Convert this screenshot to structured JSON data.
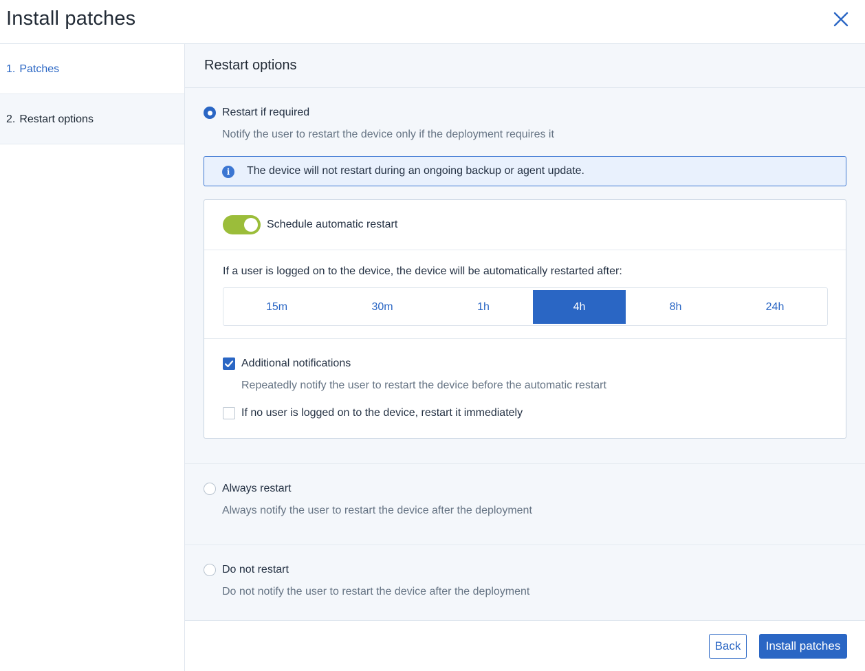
{
  "dialog": {
    "title": "Install patches"
  },
  "steps": [
    {
      "num": "1.",
      "label": "Patches"
    },
    {
      "num": "2.",
      "label": "Restart options"
    }
  ],
  "section": {
    "title": "Restart options"
  },
  "options": {
    "restart_if_required": {
      "label": "Restart if required",
      "description": "Notify the user to restart the device only if the deployment requires it",
      "selected": true
    },
    "always_restart": {
      "label": "Always restart",
      "description": "Always notify the user to restart the device after the deployment",
      "selected": false
    },
    "do_not_restart": {
      "label": "Do not restart",
      "description": "Do not notify the user to restart the device after the deployment",
      "selected": false
    }
  },
  "info": {
    "text": "The device will not restart during an ongoing backup or agent update."
  },
  "schedule": {
    "toggle_label": "Schedule automatic restart",
    "enabled": true,
    "after_label": "If a user is logged on to the device, the device will be automatically restarted after:",
    "intervals": [
      "15m",
      "30m",
      "1h",
      "4h",
      "8h",
      "24h"
    ],
    "selected_interval": "4h",
    "additional_notifications": {
      "label": "Additional notifications",
      "description": "Repeatedly notify the user to restart the device before the automatic restart",
      "checked": true
    },
    "restart_immediately": {
      "label": "If no user is logged on to the device, restart it immediately",
      "checked": false
    }
  },
  "footer": {
    "back_label": "Back",
    "install_label": "Install patches"
  },
  "colors": {
    "accent": "#2a66c4",
    "toggle_on": "#9bbd3a",
    "info_bg": "#e9f1fd",
    "panel_bg": "#f4f7fb"
  }
}
